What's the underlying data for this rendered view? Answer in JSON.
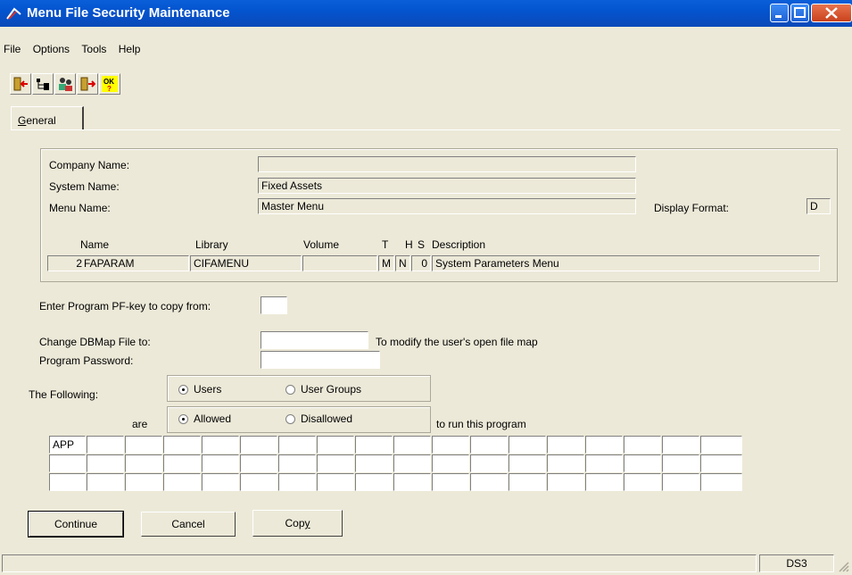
{
  "window": {
    "title": "Menu File Security Maintenance"
  },
  "menu": {
    "items": [
      "File",
      "Options",
      "Tools",
      "Help"
    ]
  },
  "toolbar": {
    "icons": [
      "exit-icon",
      "tree-icon",
      "users-icon",
      "next-icon",
      "ok-icon"
    ],
    "ok_label": "OK"
  },
  "tab": {
    "label_prefix": "",
    "label_underlined": "G",
    "label_rest": "eneral"
  },
  "header": {
    "company_label": "Company Name:",
    "company_value": "",
    "system_label": "System Name:",
    "system_value": "Fixed Assets",
    "menu_label": "Menu Name:",
    "menu_value": "Master Menu",
    "display_format_label": "Display Format:",
    "display_format_value": "D"
  },
  "program_table": {
    "headers": {
      "name": "Name",
      "library": "Library",
      "volume": "Volume",
      "t": "T",
      "h": "H",
      "s": "S",
      "description": "Description"
    },
    "row": {
      "num": "2",
      "name": "FAPARAM",
      "library": "CIFAMENU",
      "volume": "",
      "t": "M",
      "h": "N",
      "s": "0",
      "description": "System Parameters Menu"
    }
  },
  "form": {
    "pfkey_label": "Enter Program PF-key to copy from:",
    "pfkey_value": "",
    "dbmap_label": "Change DBMap File to:",
    "dbmap_value": "",
    "dbmap_hint": "To modify the user's open file map",
    "password_label": "Program Password:",
    "password_value": "",
    "following_label": "The Following:",
    "users_option": "Users",
    "user_groups_option": "User Groups",
    "are_label": "are",
    "allowed_option": "Allowed",
    "disallowed_option": "Disallowed",
    "run_hint": "to run this program",
    "selected_who": "Users",
    "selected_access": "Allowed"
  },
  "user_grid": {
    "rows": [
      [
        "APP",
        "",
        "",
        "",
        "",
        "",
        "",
        "",
        "",
        "",
        "",
        "",
        "",
        "",
        "",
        "",
        "",
        ""
      ],
      [
        "",
        "",
        "",
        "",
        "",
        "",
        "",
        "",
        "",
        "",
        "",
        "",
        "",
        "",
        "",
        "",
        "",
        ""
      ],
      [
        "",
        "",
        "",
        "",
        "",
        "",
        "",
        "",
        "",
        "",
        "",
        "",
        "",
        "",
        "",
        "",
        "",
        ""
      ]
    ]
  },
  "buttons": {
    "continue": "Continue",
    "cancel": "Cancel",
    "copy_prefix": "Cop",
    "copy_underlined": "y"
  },
  "status": {
    "panel1": "",
    "panel2": "DS3"
  }
}
